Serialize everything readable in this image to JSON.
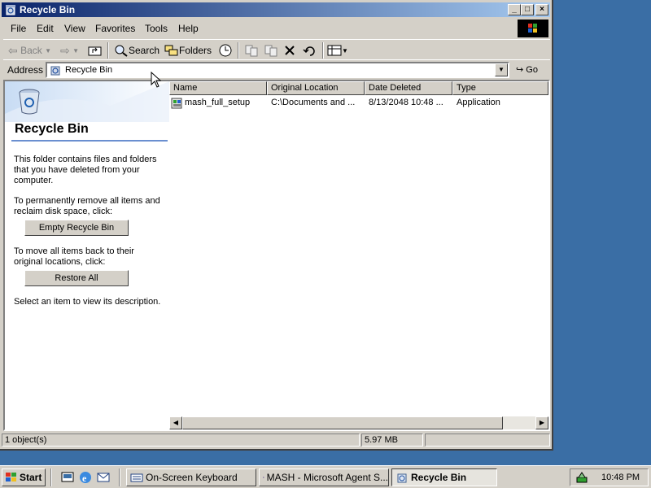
{
  "window": {
    "title": "Recycle Bin"
  },
  "titlebar_buttons": {
    "minimize": "_",
    "maximize": "□",
    "close": "×"
  },
  "menu": [
    "File",
    "Edit",
    "View",
    "Favorites",
    "Tools",
    "Help"
  ],
  "toolbar": {
    "back": "Back",
    "search": "Search",
    "folders": "Folders"
  },
  "address": {
    "label": "Address",
    "value": "Recycle Bin",
    "go": "Go"
  },
  "left_pane": {
    "title": "Recycle Bin",
    "description": "This folder contains files and folders that you have deleted from your computer.",
    "remove_text": "To permanently remove all items and reclaim disk space, click:",
    "empty_button": "Empty Recycle Bin",
    "restore_text": "To move all items back to their original locations, click:",
    "restore_button": "Restore All",
    "select_text": "Select an item to view its description."
  },
  "columns": [
    "Name",
    "Original Location",
    "Date Deleted",
    "Type"
  ],
  "rows": [
    {
      "name": "mash_full_setup",
      "location": "C:\\Documents and ...",
      "date": "8/13/2048 10:48 ...",
      "type": "Application"
    }
  ],
  "status": {
    "objects": "1 object(s)",
    "size": "5.97 MB"
  },
  "taskbar": {
    "start": "Start",
    "tasks": [
      "On-Screen Keyboard",
      "MASH - Microsoft Agent S...",
      "Recycle Bin"
    ],
    "clock": "10:48 PM"
  },
  "colors": {
    "title_start": "#0a246a",
    "title_end": "#a6caf0",
    "desktop": "#3a6ea5",
    "face": "#d4d0c8"
  }
}
